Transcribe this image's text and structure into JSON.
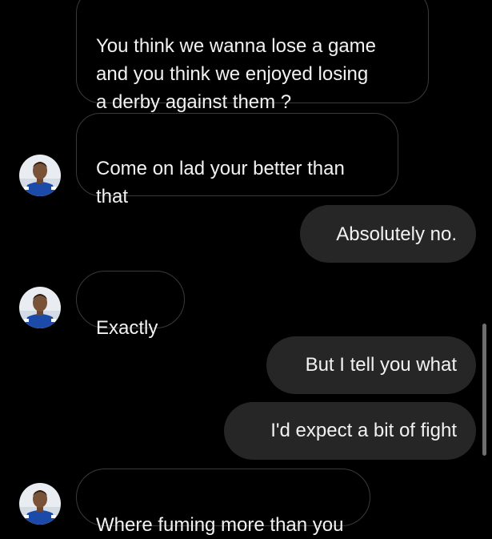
{
  "thread": {
    "messages": [
      {
        "side": "received",
        "text": "You think we wanna lose a game\nand you think we enjoyed losing\na derby against them ?"
      },
      {
        "side": "received",
        "text": "Come on lad your better than\nthat"
      },
      {
        "side": "sent",
        "text": "Absolutely no."
      },
      {
        "side": "received",
        "text": "Exactly"
      },
      {
        "side": "sent",
        "text": "But I tell you what"
      },
      {
        "side": "sent",
        "text": "I'd expect a bit of fight"
      },
      {
        "side": "received",
        "text": "Where fuming more than you"
      }
    ]
  },
  "colors": {
    "background": "#000000",
    "sent_bubble": "#262626",
    "received_border": "#3a3a3c",
    "text": "#f2f2f2",
    "avatar_kit": "#1c4aa8"
  },
  "icons": {
    "avatar": "profile-photo-person-in-blue-kit"
  }
}
